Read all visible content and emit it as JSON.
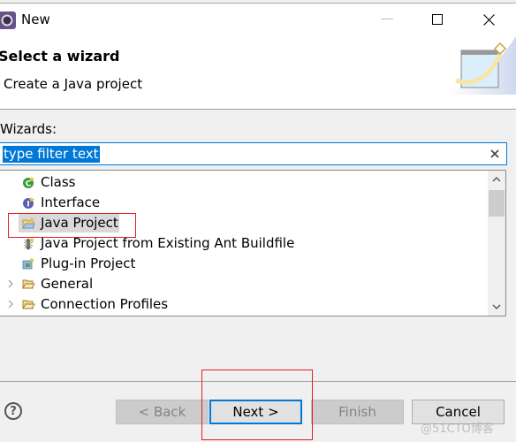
{
  "window": {
    "title": "New",
    "icon": "eclipse-gear-icon",
    "controls": {
      "minimize": "minimize-icon",
      "maximize": "maximize-icon",
      "close": "close-icon"
    }
  },
  "header": {
    "title": "Select a wizard",
    "description": "Create a Java project",
    "banner_icon": "new-wizard-banner-icon"
  },
  "wizards": {
    "label": "Wizards:",
    "filter": {
      "value": "type filter text",
      "selected": true,
      "clear_icon": "clear-icon"
    },
    "items": [
      {
        "label": "Class",
        "icon": "class-icon",
        "expandable": false,
        "selected": false
      },
      {
        "label": "Interface",
        "icon": "interface-icon",
        "expandable": false,
        "selected": false
      },
      {
        "label": "Java Project",
        "icon": "java-project-icon",
        "expandable": false,
        "selected": true
      },
      {
        "label": "Java Project from Existing Ant Buildfile",
        "icon": "ant-icon",
        "expandable": false,
        "selected": false
      },
      {
        "label": "Plug-in Project",
        "icon": "plugin-project-icon",
        "expandable": false,
        "selected": false
      },
      {
        "label": "General",
        "icon": "folder-icon",
        "expandable": true,
        "selected": false
      },
      {
        "label": "Connection Profiles",
        "icon": "folder-icon",
        "expandable": true,
        "selected": false
      }
    ]
  },
  "buttons": {
    "help": "?",
    "back": "< Back",
    "next": "Next >",
    "finish": "Finish",
    "cancel": "Cancel"
  },
  "watermark": "@51CTO博客",
  "colors": {
    "accent": "#0078d7",
    "annotation": "#e02020"
  }
}
